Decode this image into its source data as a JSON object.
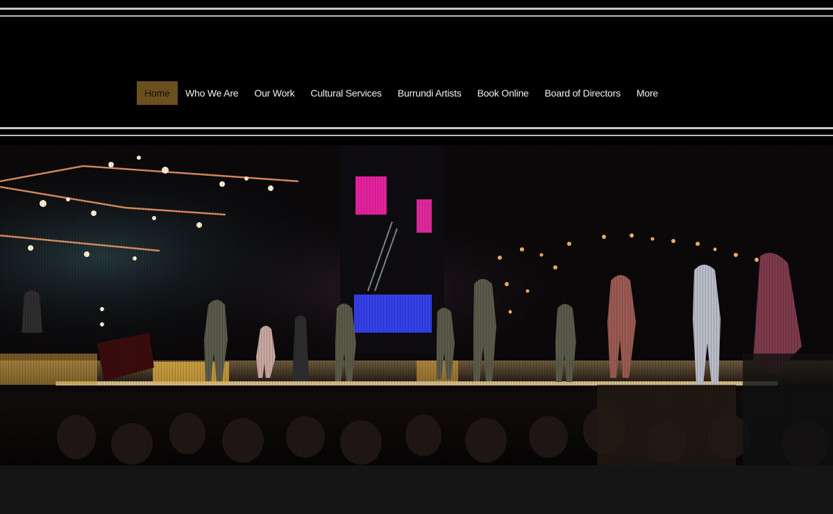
{
  "nav": {
    "items": [
      {
        "label": "Home",
        "active": true
      },
      {
        "label": "Who We Are",
        "active": false
      },
      {
        "label": "Our Work",
        "active": false
      },
      {
        "label": "Cultural Services",
        "active": false
      },
      {
        "label": "Burrundi Artists",
        "active": false
      },
      {
        "label": "Book Online",
        "active": false
      },
      {
        "label": "Board of Directors",
        "active": false
      },
      {
        "label": "More",
        "active": false
      }
    ]
  },
  "colors": {
    "header_bg": "#000000",
    "rule": "#c9c9c9",
    "active_nav_bg": "#6b4f1f",
    "nav_text": "#f2f2f2",
    "page_bg": "#151515"
  },
  "hero": {
    "image": "concert-stage-photo"
  }
}
